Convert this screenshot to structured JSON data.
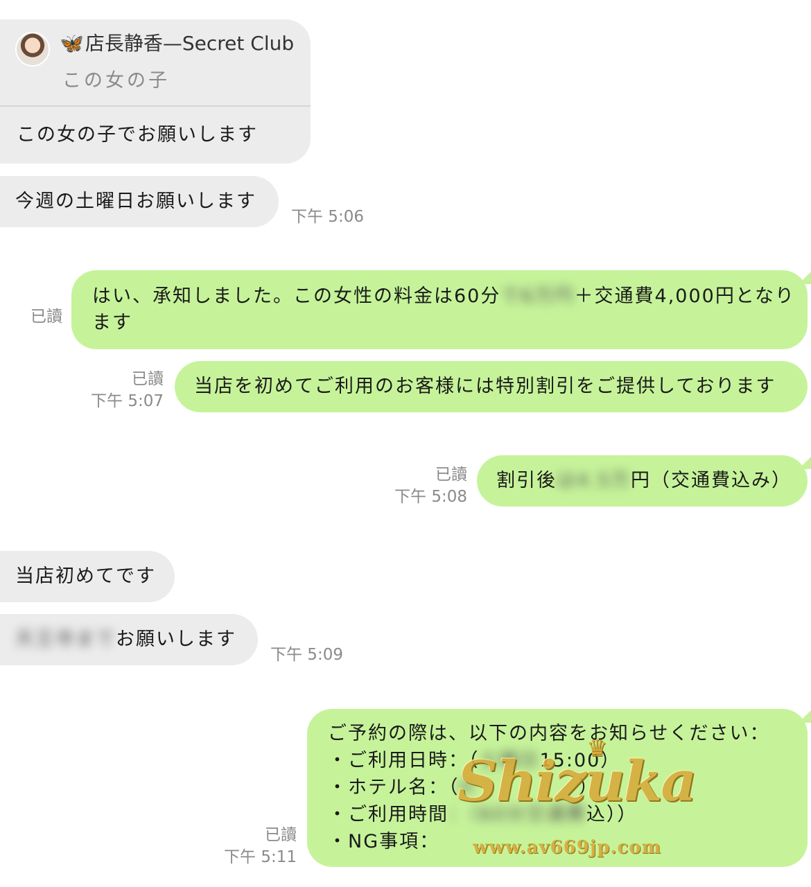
{
  "card": {
    "sender_name": "店長静香—Secret Club",
    "subtitle": "この女の子",
    "message": "この女の子でお願いします"
  },
  "messages": {
    "m1": "今週の土曜日お願いします",
    "m1_time": "下午 5:06",
    "m2_before": "はい、承知しました。この女性の料金は60分",
    "m2_blur": "で6万円",
    "m2_after": "＋交通費4,000円となり",
    "m2_line2": "ます",
    "m2_status": "已讀",
    "m3": "当店を初めてご利用のお客様には特別割引をご提供しております",
    "m3_status": "已讀",
    "m3_time": "下午 5:07",
    "m4_before": "割引後",
    "m4_blur": "は4.5万",
    "m4_after": "円（交通費込み）",
    "m4_status": "已讀",
    "m4_time": "下午 5:08",
    "m5": "当店初めてです",
    "m6_blur": "天王寺まで",
    "m6_after": "お願いします",
    "m6_time": "下午 5:09",
    "m7_line1": "ご予約の際は、以下の内容をお知らせください：",
    "m7_line2_label": "・ご利用日時：（",
    "m7_line2_blur": "土曜日",
    "m7_line2_after": "15:00）",
    "m7_line3_label": "・ホテル名：（",
    "m7_line3_blur": "H",
    "m7_line3_after": "）",
    "m7_line4_label": "・ご利用時間",
    "m7_line4_blur": "：（60分交通費",
    "m7_line4_after": "込））",
    "m7_line5": "・NG事項：",
    "m7_status": "已讀",
    "m7_time": "下午 5:11"
  },
  "watermark": {
    "brand": "Shizuka",
    "url": "www.av669jp.com"
  },
  "colors": {
    "incoming_bubble": "#ececec",
    "outgoing_bubble": "#c6f39a",
    "meta_text": "#8a8a8a",
    "watermark_gold": "#d7ac3c"
  },
  "icons": [
    "avatar",
    "butterfly-icon",
    "crown-icon"
  ]
}
